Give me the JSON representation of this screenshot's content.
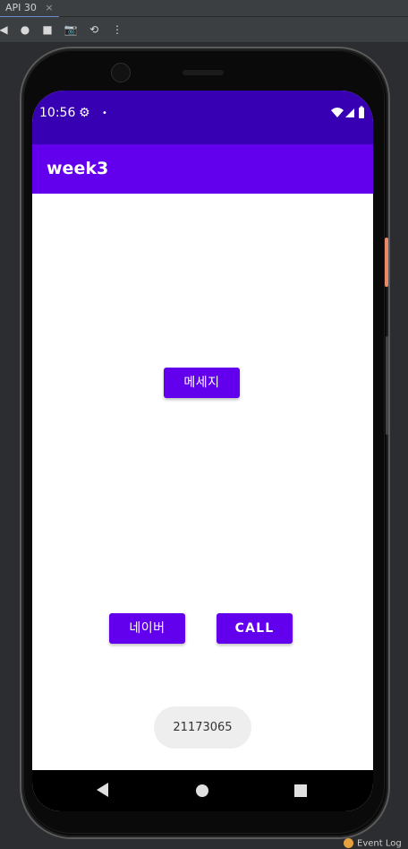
{
  "ide": {
    "tab_label": "API 30",
    "tab_close": "×",
    "toolbar": {
      "back_icon": "◀",
      "record_icon": "●",
      "stop_icon": "■",
      "camera_icon": "📷",
      "rotate_icon": "⟲",
      "more_icon": "⋮"
    },
    "event_log": "Event Log"
  },
  "device": {
    "status": {
      "time": "10:56",
      "gear_icon": "⚙",
      "dot_icon": "•"
    },
    "app": {
      "title": "week3"
    },
    "buttons": {
      "message": "메세지",
      "naver": "네이버",
      "call": "CALL"
    },
    "toast": {
      "text": "21173065"
    }
  },
  "colors": {
    "status_bar": "#3700b3",
    "app_bar": "#6200ee",
    "button": "#6200ee",
    "toast_bg": "#eeeeee"
  }
}
